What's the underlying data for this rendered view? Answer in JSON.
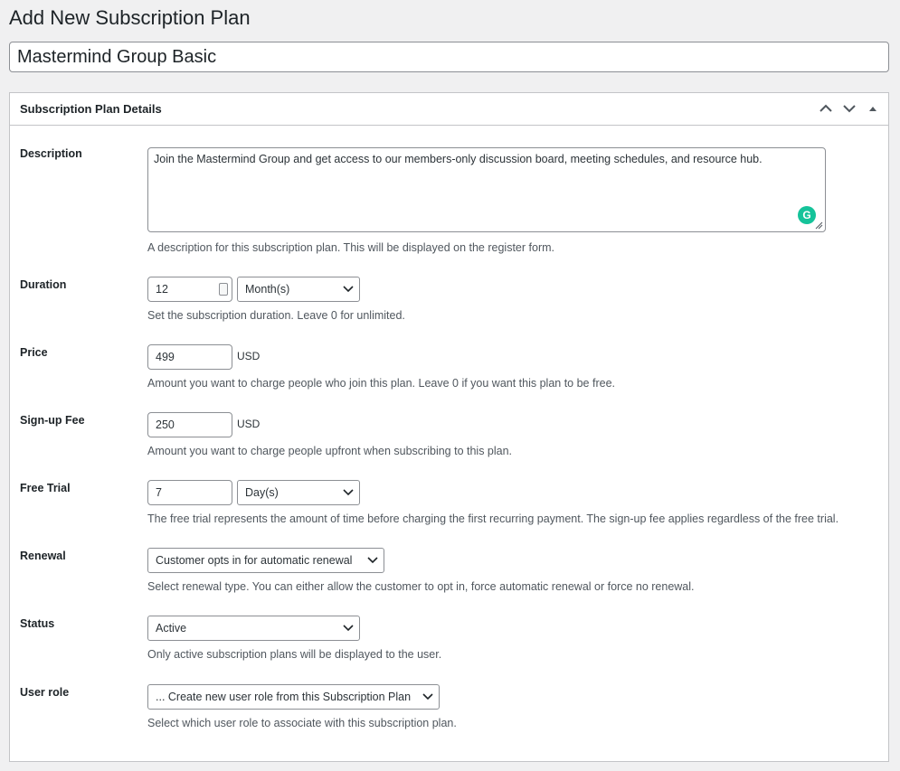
{
  "page": {
    "title": "Add New Subscription Plan"
  },
  "plan_title": {
    "value": "Mastermind Group Basic"
  },
  "postbox": {
    "title": "Subscription Plan Details",
    "icons": [
      "chevron-up-icon",
      "chevron-down-icon",
      "triangle-up-icon"
    ]
  },
  "fields": {
    "description": {
      "label": "Description",
      "value": "Join the Mastermind Group and get access to our members-only discussion board, meeting schedules, and resource hub.",
      "help": "A description for this subscription plan. This will be displayed on the register form."
    },
    "duration": {
      "label": "Duration",
      "value": "12",
      "unit_selected": "Month(s)",
      "help": "Set the subscription duration. Leave 0 for unlimited."
    },
    "price": {
      "label": "Price",
      "value": "499",
      "currency": "USD",
      "help": "Amount you want to charge people who join this plan. Leave 0 if you want this plan to be free."
    },
    "signup_fee": {
      "label": "Sign-up Fee",
      "value": "250",
      "currency": "USD",
      "help": "Amount you want to charge people upfront when subscribing to this plan."
    },
    "free_trial": {
      "label": "Free Trial",
      "value": "7",
      "unit_selected": "Day(s)",
      "help": "The free trial represents the amount of time before charging the first recurring payment. The sign-up fee applies regardless of the free trial."
    },
    "renewal": {
      "label": "Renewal",
      "selected": "Customer opts in for automatic renewal",
      "help": "Select renewal type. You can either allow the customer to opt in, force automatic renewal or force no renewal."
    },
    "status": {
      "label": "Status",
      "selected": "Active",
      "help": "Only active subscription plans will be displayed to the user."
    },
    "user_role": {
      "label": "User role",
      "selected": "... Create new user role from this Subscription Plan",
      "help": "Select which user role to associate with this subscription plan."
    }
  },
  "colors": {
    "background": "#f0f0f1",
    "border": "#c3c4c7",
    "input_border": "#8c8f94",
    "grammarly": "#15c39a"
  }
}
